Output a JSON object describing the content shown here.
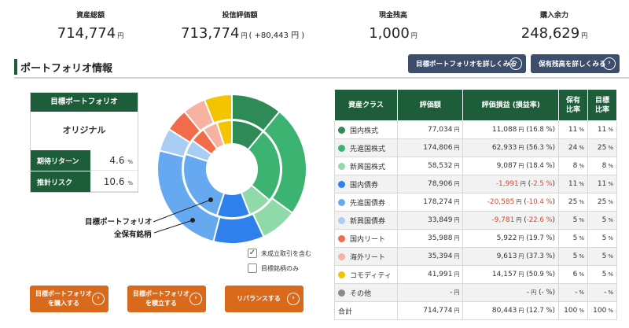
{
  "summary": [
    {
      "label": "資産総額",
      "value": "714,774",
      "unit": "円",
      "diff": ""
    },
    {
      "label": "投信評価額",
      "value": "713,774",
      "unit": "円",
      "diff": "( +80,443 円 )"
    },
    {
      "label": "現金残高",
      "value": "1,000",
      "unit": "円",
      "diff": ""
    },
    {
      "label": "購入余力",
      "value": "248,629",
      "unit": "円",
      "diff": ""
    }
  ],
  "section": {
    "title": "ポートフォリオ情報",
    "btn_target_detail": "目標ポートフォリオを詳しくみる",
    "btn_holding_detail": "保有残高を詳しくみる"
  },
  "target_portfolio": {
    "header": "目標ポートフォリオ",
    "name": "オリジナル",
    "return_label": "期待リターン",
    "return_value": "4.6",
    "risk_label": "推計リスク",
    "risk_value": "10.6",
    "percent_unit": "%"
  },
  "chart": {
    "label_target": "目標ポートフォリオ",
    "label_all": "全保有銘柄",
    "check_pending": "未成立取引を含む",
    "check_pending_checked": true,
    "check_target_only": "目標銘柄のみ",
    "check_target_only_checked": false
  },
  "buttons": {
    "buy": [
      "目標ポートフォリオ",
      "を購入する"
    ],
    "reserve": [
      "目標ポートフォリオ",
      "を積立する"
    ],
    "rebalance": "リバランスする"
  },
  "table": {
    "headers": [
      "資産クラス",
      "評価額",
      "評価損益 (損益率)",
      "保有\n比率",
      "目標\n比率"
    ],
    "rows": [
      {
        "name": "国内株式",
        "color": "#2e8b57",
        "value": "77,034",
        "pl": "11,088",
        "rate": "16.8 %",
        "neg": false,
        "hold": "11",
        "target": "11"
      },
      {
        "name": "先進国株式",
        "color": "#3cb371",
        "value": "174,806",
        "pl": "62,933",
        "rate": "56.3 %",
        "neg": false,
        "hold": "24",
        "target": "25"
      },
      {
        "name": "新興国株式",
        "color": "#90d9a8",
        "value": "58,532",
        "pl": "9,087",
        "rate": "18.4 %",
        "neg": false,
        "hold": "8",
        "target": "8"
      },
      {
        "name": "国内債券",
        "color": "#2f80ed",
        "value": "78,906",
        "pl": "-1,991",
        "rate": "-2.5 %",
        "neg": true,
        "hold": "11",
        "target": "11"
      },
      {
        "name": "先進国債券",
        "color": "#67a9f0",
        "value": "178,274",
        "pl": "-20,585",
        "rate": "-10.4 %",
        "neg": true,
        "hold": "25",
        "target": "25"
      },
      {
        "name": "新興国債券",
        "color": "#a9cdf5",
        "value": "33,849",
        "pl": "-9,781",
        "rate": "-22.6 %",
        "neg": true,
        "hold": "5",
        "target": "5"
      },
      {
        "name": "国内リート",
        "color": "#f26b4a",
        "value": "35,988",
        "pl": "5,922",
        "rate": "19.7 %",
        "neg": false,
        "hold": "5",
        "target": "5"
      },
      {
        "name": "海外リート",
        "color": "#f7b2a2",
        "value": "35,394",
        "pl": "9,613",
        "rate": "37.3 %",
        "neg": false,
        "hold": "5",
        "target": "5"
      },
      {
        "name": "コモディティ",
        "color": "#f5c400",
        "value": "41,991",
        "pl": "14,157",
        "rate": "50.9 %",
        "neg": false,
        "hold": "6",
        "target": "5"
      },
      {
        "name": "その他",
        "color": "#8a8a8a",
        "value": "-",
        "pl": "-",
        "rate": "- %",
        "neg": false,
        "hold": "-",
        "target": "-"
      }
    ],
    "total": {
      "name": "合計",
      "value": "714,774",
      "pl": "80,443",
      "rate": "12.7 %",
      "hold": "100",
      "target": "100"
    },
    "yen": "円",
    "percent": "%"
  },
  "chart_data": {
    "type": "pie",
    "categories": [
      "国内株式",
      "先進国株式",
      "新興国株式",
      "国内債券",
      "先進国債券",
      "新興国債券",
      "国内リート",
      "海外リート",
      "コモディティ"
    ],
    "colors": [
      "#2e8b57",
      "#3cb371",
      "#90d9a8",
      "#2f80ed",
      "#67a9f0",
      "#a9cdf5",
      "#f26b4a",
      "#f7b2a2",
      "#f5c400"
    ],
    "series": [
      {
        "name": "目標ポートフォリオ",
        "ring": "inner",
        "values": [
          11,
          25,
          8,
          11,
          25,
          5,
          5,
          5,
          5
        ]
      },
      {
        "name": "全保有銘柄",
        "ring": "outer",
        "values": [
          11,
          24,
          8,
          11,
          25,
          5,
          5,
          5,
          6
        ]
      }
    ]
  }
}
